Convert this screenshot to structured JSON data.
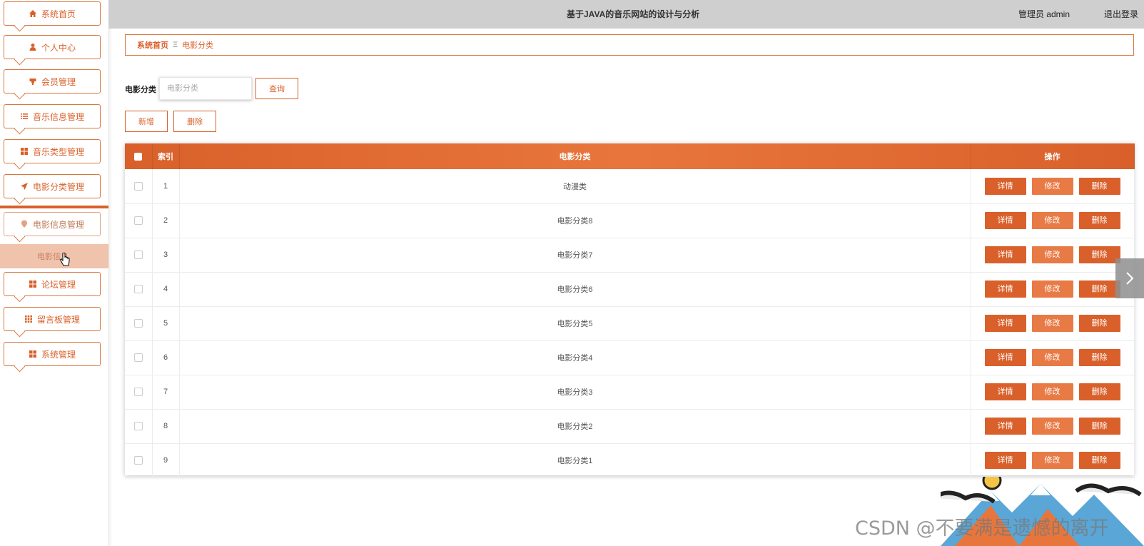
{
  "header": {
    "title": "基于JAVA的音乐网站的设计与分析",
    "admin_label": "管理员 admin",
    "logout": "退出登录"
  },
  "sidebar": {
    "items": [
      {
        "label": "系统首页",
        "icon": "home-icon"
      },
      {
        "label": "个人中心",
        "icon": "user-icon"
      },
      {
        "label": "会员管理",
        "icon": "member-icon"
      },
      {
        "label": "音乐信息管理",
        "icon": "list-icon"
      },
      {
        "label": "音乐类型管理",
        "icon": "grid-icon"
      },
      {
        "label": "电影分类管理",
        "icon": "send-icon"
      },
      {
        "label": "电影信息管理",
        "icon": "location-icon"
      },
      {
        "label": "论坛管理",
        "icon": "grid-icon"
      },
      {
        "label": "留言板管理",
        "icon": "apps-icon"
      },
      {
        "label": "系统管理",
        "icon": "grid-icon"
      }
    ],
    "submenu_label": "电影信息"
  },
  "breadcrumb": {
    "home": "系统首页",
    "separator": "Ξ",
    "current": "电影分类"
  },
  "search": {
    "label": "电影分类",
    "placeholder": "电影分类",
    "query_button": "查询"
  },
  "toolbar": {
    "add_button": "新增",
    "delete_button": "删除"
  },
  "table": {
    "columns": [
      "索引",
      "电影分类",
      "操作"
    ],
    "actions": [
      "详情",
      "修改",
      "删除"
    ],
    "rows": [
      {
        "index": "1",
        "category": "动漫类"
      },
      {
        "index": "2",
        "category": "电影分类8"
      },
      {
        "index": "3",
        "category": "电影分类7"
      },
      {
        "index": "4",
        "category": "电影分类6"
      },
      {
        "index": "5",
        "category": "电影分类5"
      },
      {
        "index": "6",
        "category": "电影分类4"
      },
      {
        "index": "7",
        "category": "电影分类3"
      },
      {
        "index": "8",
        "category": "电影分类2"
      },
      {
        "index": "9",
        "category": "电影分类1"
      }
    ]
  },
  "watermark": "CSDN @不要满是遗憾的离开",
  "colors": {
    "accent": "#d9602a",
    "accent_light": "#e87a45",
    "topbar": "#cfcfcf",
    "submenu_bg": "#f0c3ad"
  }
}
